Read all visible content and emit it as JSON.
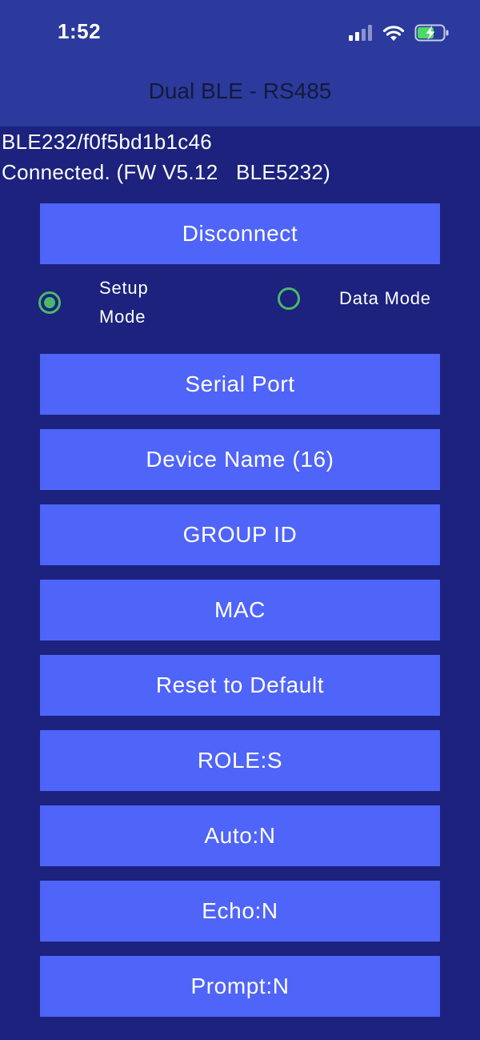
{
  "status_bar": {
    "time": "1:52",
    "signal_icon": "cellular-signal-icon",
    "wifi_icon": "wifi-icon",
    "battery_icon": "battery-charging-icon"
  },
  "nav": {
    "title": "Dual BLE - RS485"
  },
  "device": {
    "address": "BLE232/f0f5bd1b1c46",
    "connection_status": "Connected. (FW V5.12   BLE5232)"
  },
  "buttons": {
    "disconnect": "Disconnect",
    "serial_port": "Serial Port",
    "device_name": "Device Name (16)",
    "group_id": "GROUP ID",
    "mac": "MAC",
    "reset_default": "Reset to Default",
    "role": "ROLE:S",
    "auto": "Auto:N",
    "echo": "Echo:N",
    "prompt": "Prompt:N"
  },
  "mode": {
    "setup_label_line1": "Setup",
    "setup_label_line2": "Mode",
    "data_label": "Data Mode",
    "selected": "Setup Mode"
  },
  "colors": {
    "background": "#1c227d",
    "header": "#2b3a9c",
    "button": "#4f64f8",
    "radio": "#49b86a"
  }
}
